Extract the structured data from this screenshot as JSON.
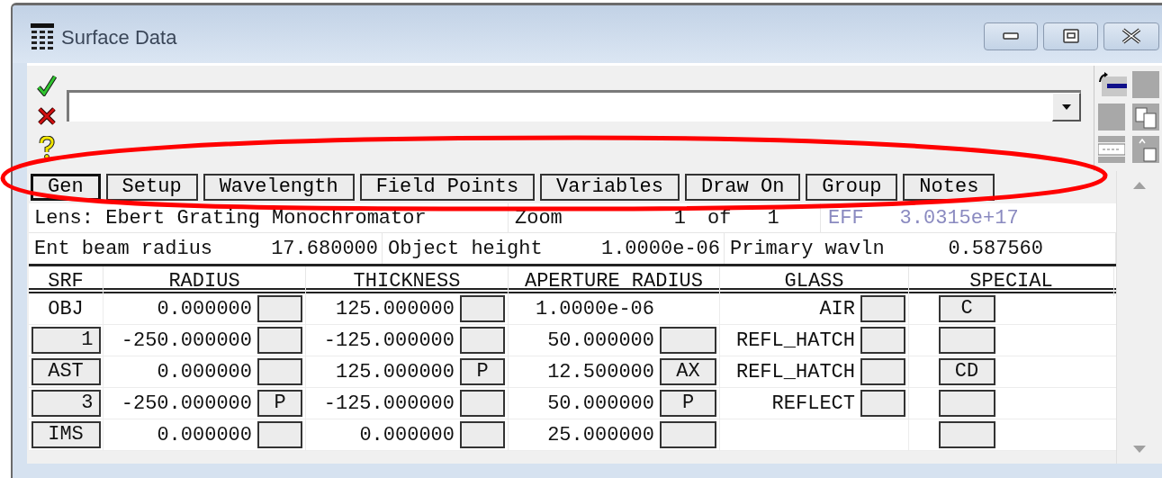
{
  "window": {
    "title": "Surface Data"
  },
  "tabs": [
    {
      "label": "Gen",
      "selected": true
    },
    {
      "label": "Setup",
      "selected": false
    },
    {
      "label": "Wavelength",
      "selected": false
    },
    {
      "label": "Field Points",
      "selected": false
    },
    {
      "label": "Variables",
      "selected": false
    },
    {
      "label": "Draw On",
      "selected": false
    },
    {
      "label": "Group",
      "selected": false
    },
    {
      "label": "Notes",
      "selected": false
    }
  ],
  "lens_row": {
    "lens": "Lens: Ebert Grating Monochromator",
    "zoom_label": "Zoom",
    "zoom_value": "1",
    "zoom_of": "of",
    "zoom_total": "1",
    "eff_label": "EFF",
    "eff_value": "3.0315e+17"
  },
  "params_row": [
    {
      "label": "Ent beam radius",
      "value": "17.680000"
    },
    {
      "label": "Object height",
      "value": "1.0000e-06"
    },
    {
      "label": "Primary wavln",
      "value": "0.587560"
    }
  ],
  "table": {
    "columns": [
      "SRF",
      "RADIUS",
      "THICKNESS",
      "APERTURE RADIUS",
      "GLASS",
      "SPECIAL"
    ],
    "rows": [
      {
        "srf": {
          "label": "OBJ",
          "button": false
        },
        "radius": {
          "value": "0.000000",
          "button": true
        },
        "thickness": {
          "value": "125.000000",
          "button": true
        },
        "aperture": {
          "value": "1.0000e-06",
          "button": false
        },
        "glass": {
          "value": "AIR",
          "button": true
        },
        "special": {
          "button": true,
          "label": "C"
        }
      },
      {
        "srf": {
          "label": "1",
          "button": true
        },
        "radius": {
          "value": "-250.000000",
          "button": true
        },
        "thickness": {
          "value": "-125.000000",
          "button": true
        },
        "aperture": {
          "value": "50.000000",
          "button": true
        },
        "glass": {
          "value": "REFL_HATCH",
          "button": true
        },
        "special": {
          "button": true
        }
      },
      {
        "srf": {
          "label": "AST",
          "button": true
        },
        "radius": {
          "value": "0.000000",
          "button": true
        },
        "thickness": {
          "value": "125.000000",
          "button": true,
          "solve": "P"
        },
        "aperture": {
          "value": "12.500000",
          "button": true,
          "solve": "AX"
        },
        "glass": {
          "value": "REFL_HATCH",
          "button": true
        },
        "special": {
          "button": true,
          "label": "CD"
        }
      },
      {
        "srf": {
          "label": "3",
          "button": true
        },
        "radius": {
          "value": "-250.000000",
          "button": true,
          "solve": "P"
        },
        "thickness": {
          "value": "-125.000000",
          "button": true
        },
        "aperture": {
          "value": "50.000000",
          "button": true,
          "solve": "P"
        },
        "glass": {
          "value": "REFLECT",
          "button": true
        },
        "special": {
          "button": true
        }
      },
      {
        "srf": {
          "label": "IMS",
          "button": true
        },
        "radius": {
          "value": "0.000000",
          "button": true
        },
        "thickness": {
          "value": "0.000000",
          "button": true
        },
        "aperture": {
          "value": "25.000000",
          "button": true
        },
        "glass": {
          "button": false
        },
        "special": {
          "button": true
        }
      }
    ]
  }
}
